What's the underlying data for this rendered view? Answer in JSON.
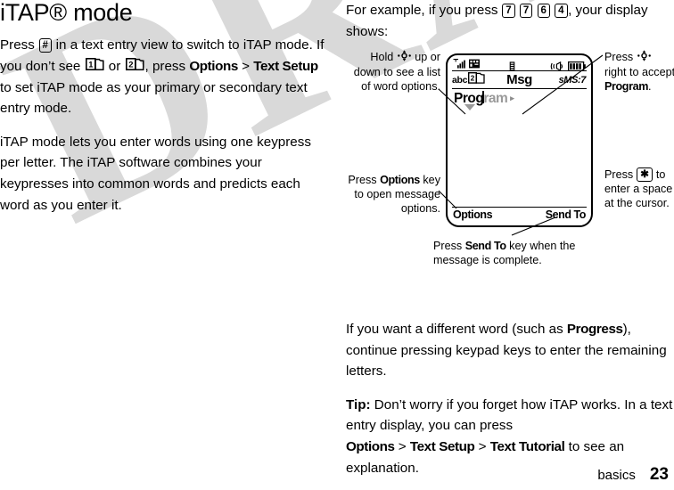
{
  "watermark": {
    "text": "DRAFT"
  },
  "page": {
    "title": "iTAP® mode",
    "footer_section": "basics",
    "footer_number": "23"
  },
  "left_column": {
    "paragraph1": {
      "part1": "Press ",
      "key_hash": "#",
      "part2": " in a text entry view to switch to iTAP mode. If you don’t see ",
      "icon1": "1",
      "part3": " or ",
      "icon2": "2",
      "part4": ", press ",
      "bold1": "Options",
      "sep": " > ",
      "bold2": "Text Setup",
      "part5": " to set iTAP mode as your primary or secondary text entry mode."
    },
    "paragraph2": "iTAP mode lets you enter words using one keypress per letter. The iTAP software combines your keypresses into common words and predicts each word as you enter it."
  },
  "right_column": {
    "intro": {
      "part1": "For example, if you press ",
      "keys": [
        "7",
        "7",
        "6",
        "4"
      ],
      "part2": ", your display shows:"
    },
    "paragraph_different_word": {
      "part1": "If you want a different word (such as ",
      "bold": "Progress",
      "part2": "), continue pressing keypad keys to enter the remaining letters."
    },
    "tip": {
      "label": "Tip:",
      "part1": " Don’t worry if you forget how iTAP works. In a text entry display, you can press ",
      "path": [
        "Options",
        "Text Setup",
        "Text Tutorial"
      ],
      "separator": " > ",
      "part2": " to see an explanation."
    }
  },
  "figure": {
    "phone_display": {
      "status_icons": {
        "signal": "signal-strength-icon",
        "roam": "roam-icon",
        "sim": "sim-card-icon",
        "ringer": "ringer-vibrate-icon",
        "battery": "battery-full-icon"
      },
      "entry_mode_label": "abc",
      "entry_mode_icon": "text-mode-book-2-icon",
      "title": "Msg",
      "char_counter": "sMS:7",
      "typed_text": "Prog",
      "predicted_text": "ram",
      "next_word_arrow": "▸",
      "softkey_left": "Options",
      "softkey_right": "Send To"
    },
    "callouts": {
      "hold_nav": {
        "part1": "Hold ",
        "icon": "navigation-key-icon",
        "part2": " up or down to see a list of word options."
      },
      "press_options": {
        "part1": "Press ",
        "bold": "Options",
        "part2": " key to open message options."
      },
      "press_accept": {
        "part1": "Press ",
        "icon": "navigation-key-icon",
        "part2": " right to accept ",
        "bold": "Program",
        "part3": "."
      },
      "press_star": {
        "part1": "Press ",
        "key": "✱",
        "part2": " to enter a space at the cursor."
      },
      "press_sendto": {
        "part1": "Press ",
        "bold": "Send To",
        "part2": " key when the message is complete."
      }
    }
  },
  "colors": {
    "text": "#000000",
    "watermark": "#d9d9d9",
    "predicted_text": "#9a9a9a"
  }
}
